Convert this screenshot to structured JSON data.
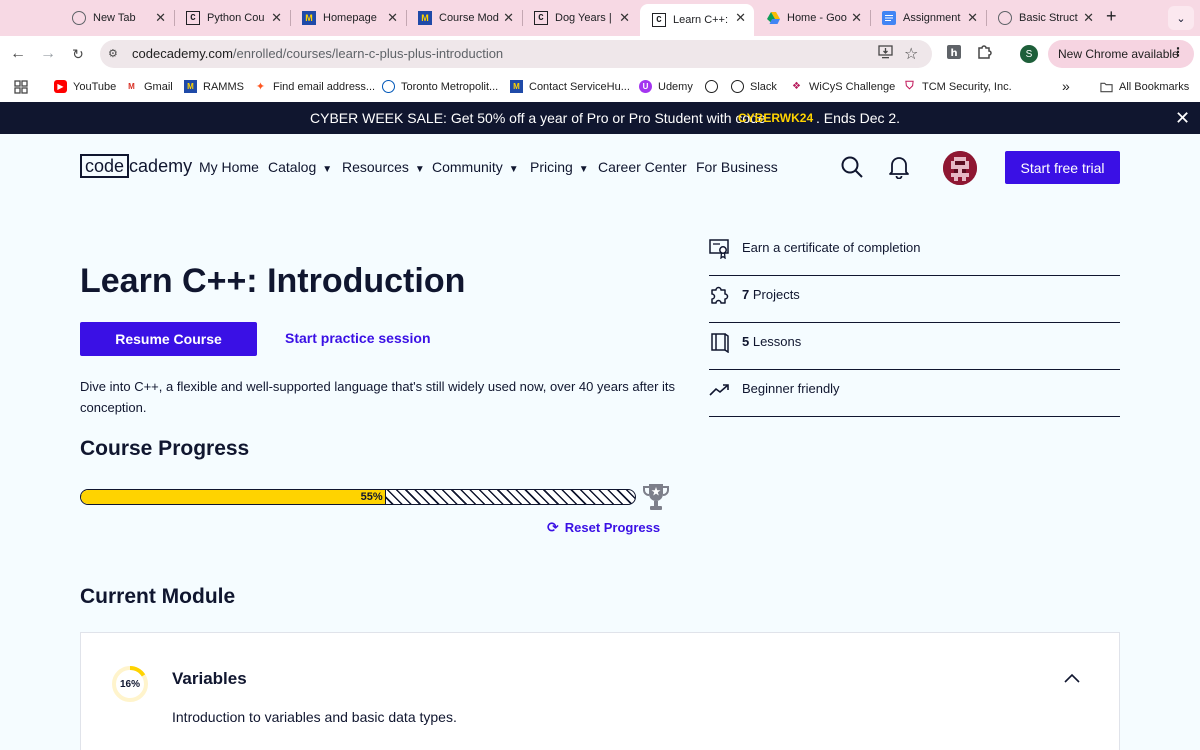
{
  "browser": {
    "tabs": [
      {
        "label": "New Tab",
        "icon": "chrome-icon",
        "active": false
      },
      {
        "label": "Python Cou",
        "icon": "codecademy-icon",
        "active": false
      },
      {
        "label": "Homepage",
        "icon": "m-icon",
        "active": false
      },
      {
        "label": "Course Mod",
        "icon": "m-icon",
        "active": false
      },
      {
        "label": "Dog Years |",
        "icon": "codecademy-icon",
        "active": false
      },
      {
        "label": "Learn C++:",
        "icon": "codecademy-icon",
        "active": true
      },
      {
        "label": "Home - Goo",
        "icon": "drive-icon",
        "active": false
      },
      {
        "label": "Assignment",
        "icon": "docs-icon",
        "active": false
      },
      {
        "label": "Basic Struct",
        "icon": "globe-icon",
        "active": false
      }
    ],
    "close_glyph": "✕",
    "url": {
      "domain": "codecademy.com",
      "path": "/enrolled/courses/learn-c-plus-plus-introduction"
    },
    "profile_initial": "S",
    "new_chrome_label": "New Chrome available",
    "bookmarks": [
      {
        "label": "YouTube"
      },
      {
        "label": "Gmail"
      },
      {
        "label": "RAMMS"
      },
      {
        "label": "Find email address..."
      },
      {
        "label": "Toronto Metropolit..."
      },
      {
        "label": "Contact ServiceHu..."
      },
      {
        "label": "Udemy"
      },
      {
        "label": ""
      },
      {
        "label": "Slack"
      },
      {
        "label": "WiCyS Challenge"
      },
      {
        "label": "TCM Security, Inc."
      }
    ],
    "more_bookmarks": "»",
    "all_bookmarks": "All Bookmarks"
  },
  "promo": {
    "text": "CYBER WEEK SALE: Get 50% off a year of Pro or Pro Student with code",
    "code": "CYBERWK24",
    "ends": ". Ends Dec 2."
  },
  "header": {
    "logo_boxed": "code",
    "logo_rest": "cademy",
    "nav": [
      {
        "label": "My Home",
        "dropdown": false
      },
      {
        "label": "Catalog",
        "dropdown": true
      },
      {
        "label": "Resources",
        "dropdown": true
      },
      {
        "label": "Community",
        "dropdown": true
      },
      {
        "label": "Pricing",
        "dropdown": true
      },
      {
        "label": "Career Center",
        "dropdown": false
      },
      {
        "label": "For Business",
        "dropdown": false
      }
    ],
    "caret": "▼",
    "start_trial": "Start free trial"
  },
  "course": {
    "title": "Learn C++: Introduction",
    "resume_label": "Resume Course",
    "practice_label": "Start practice session",
    "description": "Dive into C++, a flexible and well-supported language that's still widely used now, over 40 years after its conception.",
    "progress_heading": "Course Progress",
    "progress_percent": 55,
    "progress_label": "55%",
    "reset_label": "Reset Progress",
    "stats": [
      {
        "icon": "certificate-icon",
        "bold": "",
        "text": "Earn a certificate of completion"
      },
      {
        "icon": "puzzle-icon",
        "bold": "7",
        "text": " Projects"
      },
      {
        "icon": "book-icon",
        "bold": "5",
        "text": " Lessons"
      },
      {
        "icon": "trend-icon",
        "bold": "",
        "text": "Beginner friendly"
      }
    ]
  },
  "module": {
    "heading": "Current Module",
    "progress_percent": 16,
    "progress_label": "16%",
    "title": "Variables",
    "description": "Introduction to variables and basic data types."
  },
  "colors": {
    "accent": "#3a10e5",
    "yellow": "#ffd300",
    "navy": "#10162f",
    "page_bg": "#f5fcff",
    "tab_strip": "#f7d9e4"
  }
}
